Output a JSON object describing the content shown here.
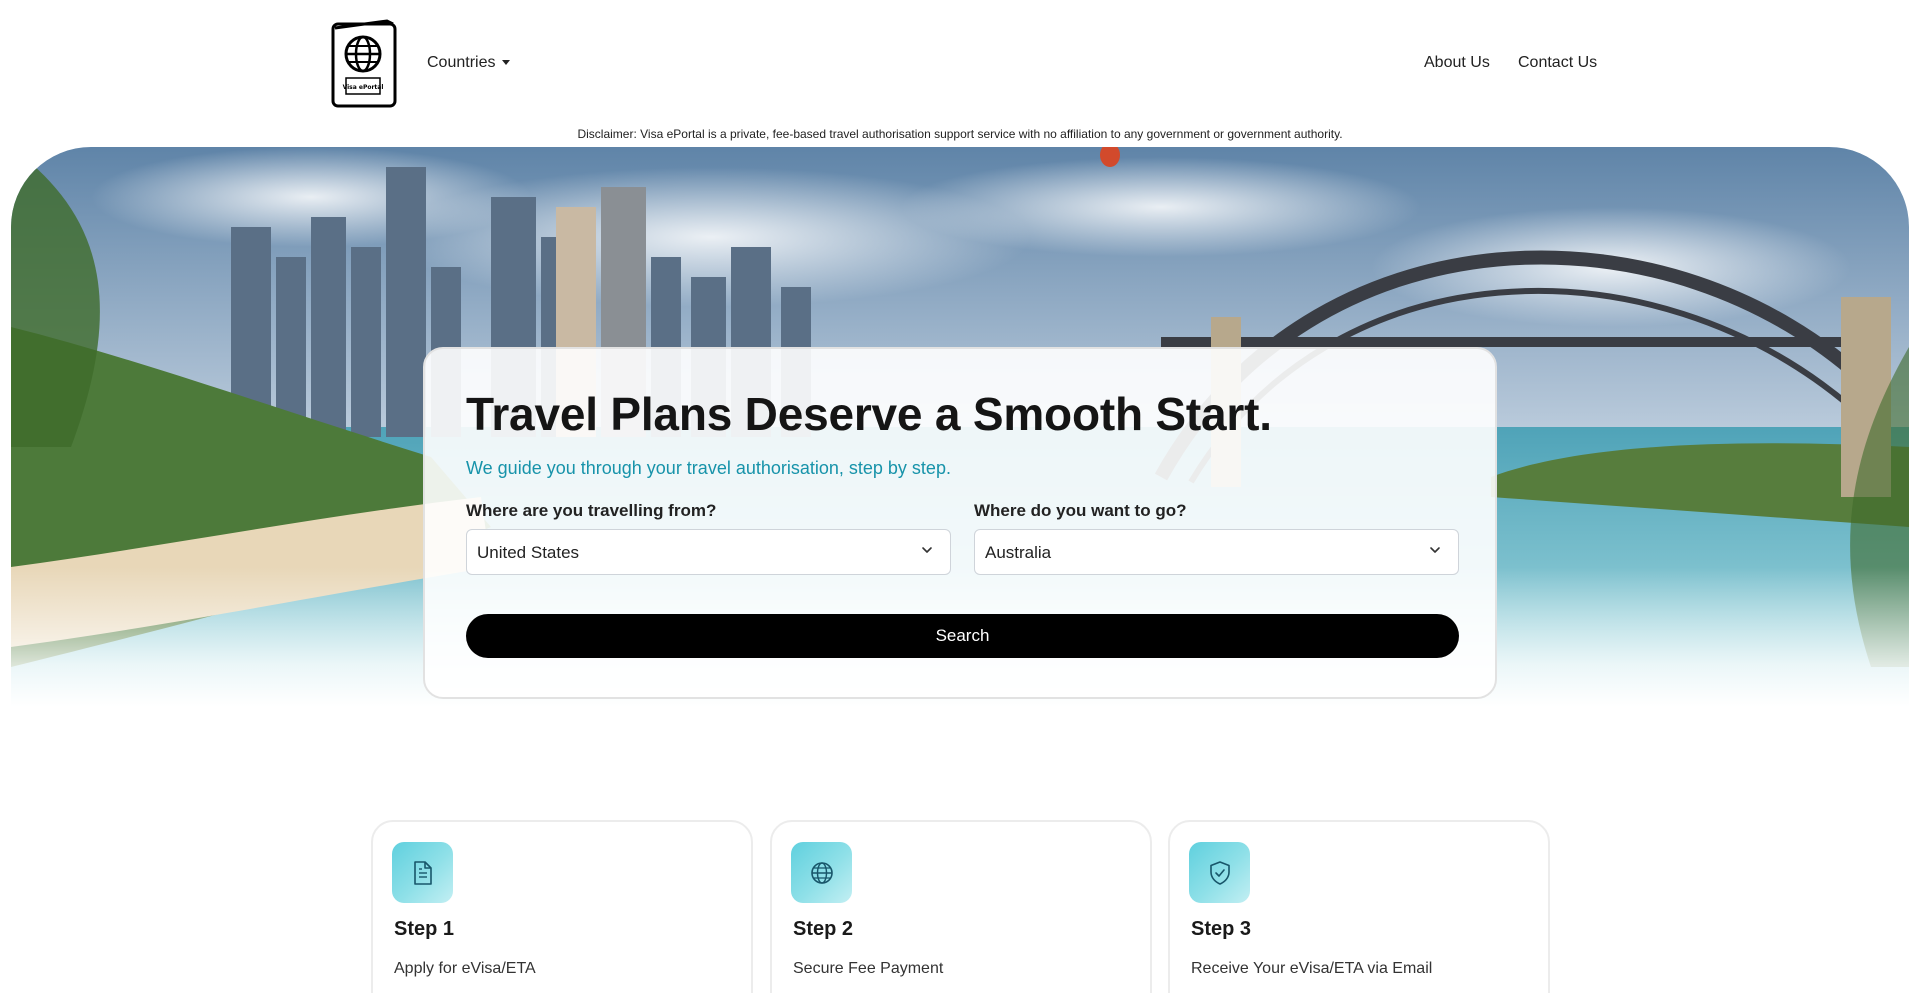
{
  "header": {
    "logo_icon": "passport-icon",
    "logo_text": "Visa ePortal",
    "countries_label": "Countries",
    "about_label": "About Us",
    "contact_label": "Contact Us"
  },
  "disclaimer": "Disclaimer: Visa ePortal is a private, fee-based travel authorisation support service with no affiliation to any government or government authority.",
  "hero": {
    "title": "Travel Plans Deserve a Smooth Start.",
    "subtitle": "We guide you through your travel authorisation, step by step.",
    "from_label": "Where are you travelling from?",
    "from_value": "United States",
    "to_label": "Where do you want to go?",
    "to_value": "Australia",
    "search_label": "Search"
  },
  "steps": [
    {
      "icon": "document-icon",
      "title": "Step 1",
      "description": "Apply for eVisa/ETA"
    },
    {
      "icon": "globe-icon",
      "title": "Step 2",
      "description": "Secure Fee Payment"
    },
    {
      "icon": "shield-check-icon",
      "title": "Step 3",
      "description": "Receive Your eVisa/ETA via Email"
    }
  ],
  "colors": {
    "accent": "#1793aa",
    "button": "#000000",
    "icon_tile": "#5fd0de"
  }
}
